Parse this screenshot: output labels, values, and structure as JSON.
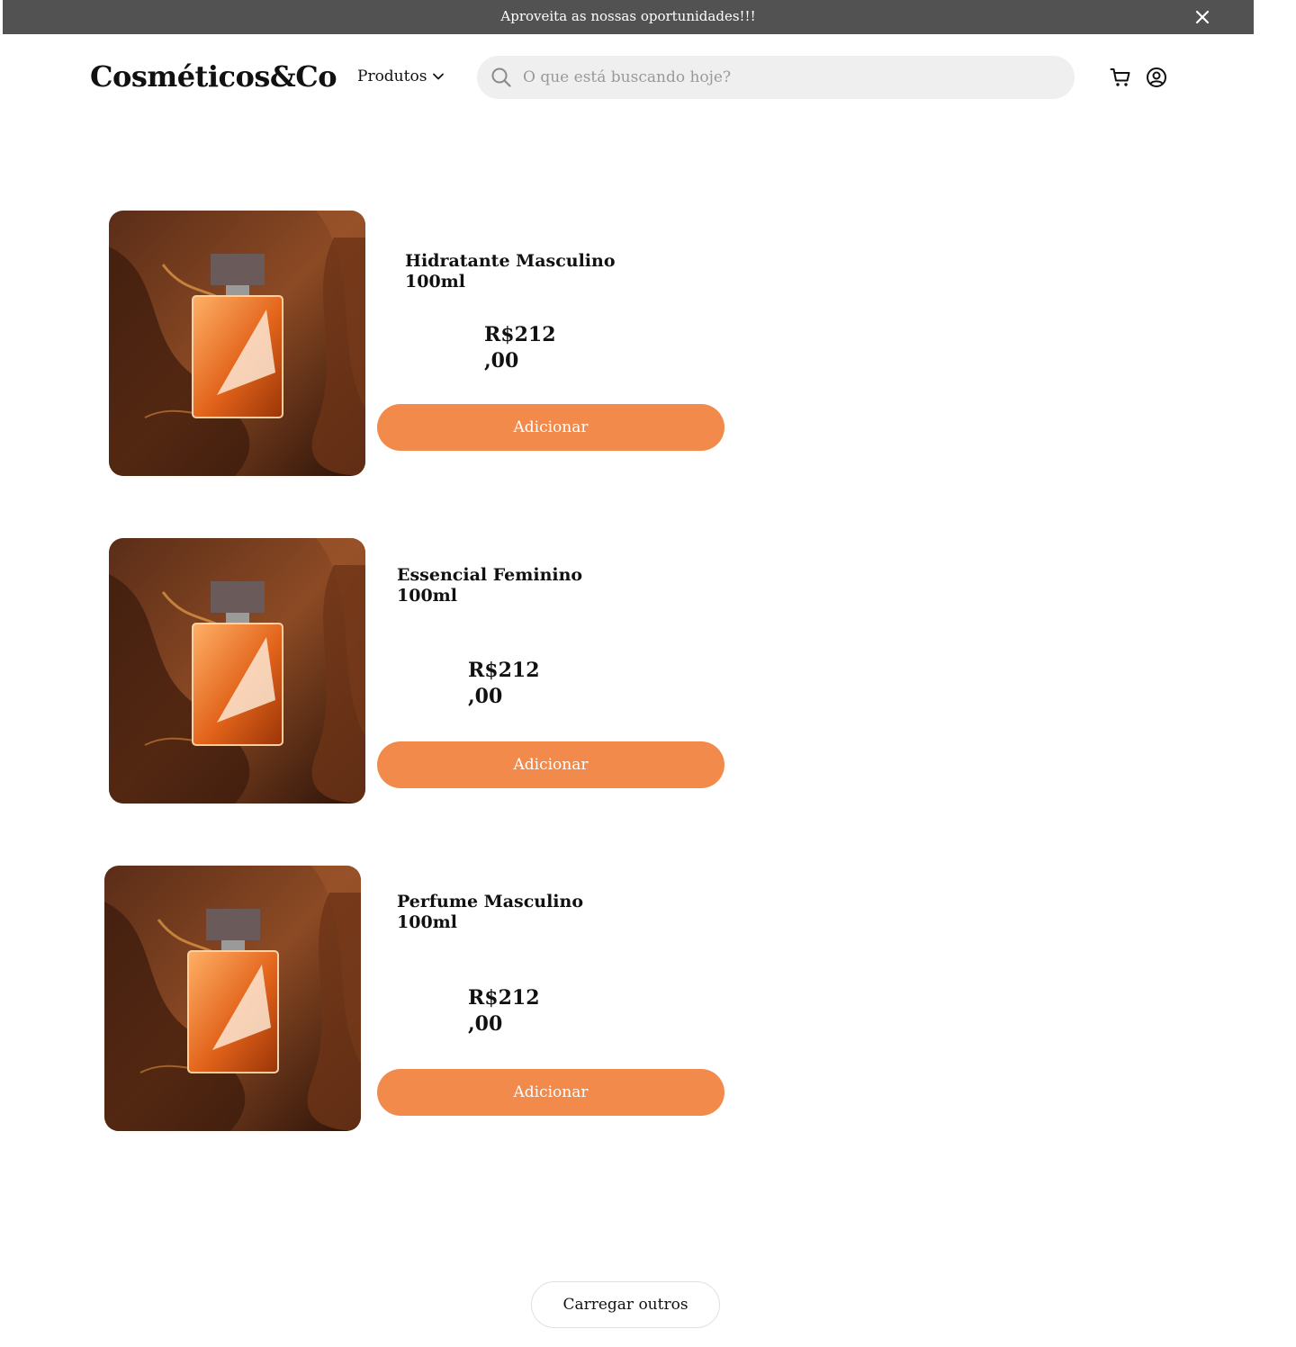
{
  "announcement": {
    "text": "Aproveita as nossas oportunidades!!!",
    "close_icon": "close-icon"
  },
  "header": {
    "logo": "Cosméticos&Co",
    "nav_products": "Produtos",
    "search_placeholder": "O que está buscando hoje?",
    "cart_icon": "cart-icon",
    "user_icon": "user-circle-icon"
  },
  "products": [
    {
      "name": "Hidratante Masculino 100ml",
      "price": "R$212\n,00",
      "button": "Adicionar"
    },
    {
      "name": "Essencial Feminino 100ml",
      "price": "R$212\n,00",
      "button": "Adicionar"
    },
    {
      "name": "Perfume Masculino 100ml",
      "price": "R$212\n,00",
      "button": "Adicionar"
    }
  ],
  "load_more": "Carregar outros",
  "colors": {
    "accent": "#f28a4b",
    "announcement_bg": "#525252",
    "search_bg": "#efefef"
  }
}
